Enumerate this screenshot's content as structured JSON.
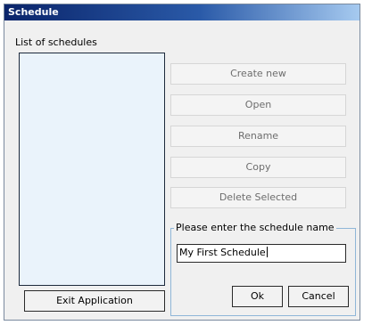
{
  "window": {
    "title": "Schedule"
  },
  "list": {
    "label": "List of schedules",
    "items": []
  },
  "actions": {
    "create_new": "Create new",
    "open": "Open",
    "rename": "Rename",
    "copy": "Copy",
    "delete_selected": "Delete Selected"
  },
  "name_group": {
    "legend": "Please enter the schedule name",
    "value": "My First Schedule",
    "ok": "Ok",
    "cancel": "Cancel"
  },
  "exit": "Exit Application"
}
